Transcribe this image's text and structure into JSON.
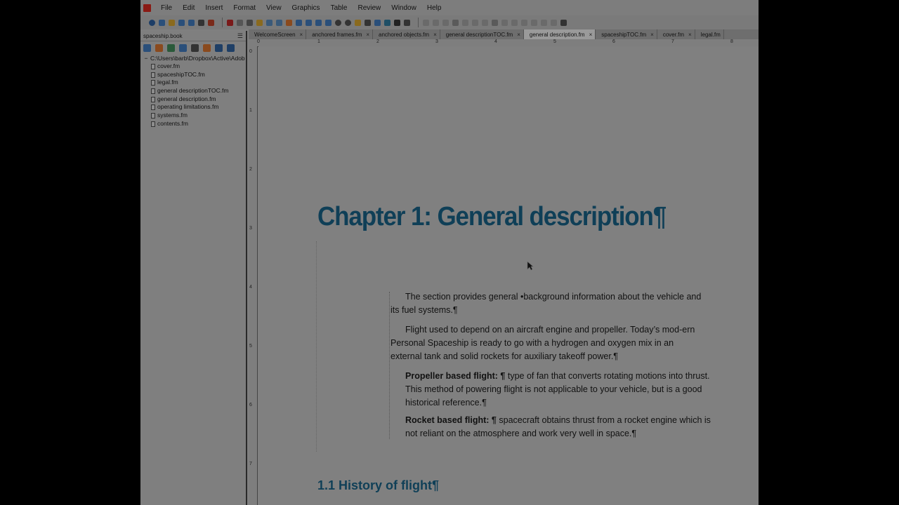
{
  "menubar": {
    "items": [
      "File",
      "Edit",
      "Insert",
      "Format",
      "View",
      "Graphics",
      "Table",
      "Review",
      "Window",
      "Help"
    ]
  },
  "book": {
    "title": "spaceship.book",
    "root": "C:\\Users\\barb\\Dropbox\\Active\\Adob",
    "files": [
      "cover.fm",
      "spaceshipTOC.fm",
      "legal.fm",
      "general descriptionTOC.fm",
      "general description.fm",
      "operating limitations.fm",
      "systems.fm",
      "contents.fm"
    ]
  },
  "tabs": [
    {
      "label": "WelcomeScreen"
    },
    {
      "label": "anchored frames.fm"
    },
    {
      "label": "anchored objects.fm"
    },
    {
      "label": "general descriptionTOC.fm"
    },
    {
      "label": "general description.fm"
    },
    {
      "label": "spaceshipTOC.fm"
    },
    {
      "label": "cover.fm"
    },
    {
      "label": "legal.fm"
    }
  ],
  "ruler": {
    "h_ticks": [
      "0",
      "1",
      "2",
      "3",
      "4",
      "5",
      "6",
      "7",
      "8"
    ],
    "v_ticks": [
      "0",
      "1",
      "2",
      "3",
      "4",
      "5",
      "6",
      "7"
    ]
  },
  "document": {
    "chapter_title": "Chapter 1: General description¶",
    "para1": "The section provides general •background information about the vehicle and its fuel systems.¶",
    "para2": "Flight used to depend on an aircraft engine and propeller. Today’s mod-ern Personal Spaceship is ready to go with a hydrogen and oxygen mix in an external tank and solid rockets for auxiliary takeoff power.¶",
    "prop_term": "Propeller based flight: ¶",
    "prop_text": " type of fan that converts rotating motions into thrust. This method of powering flight is not applicable to your vehicle, but is a good historical reference.¶",
    "rocket_term": "Rocket based flight: ¶",
    "rocket_text": " spacecraft obtains thrust from a rocket engine which is not reliant on the atmosphere and work very well in space.¶",
    "section_heading": "1.1 History of flight¶"
  },
  "colors": {
    "heading": "#0f3f57",
    "app_icon": "#8a1a14"
  }
}
